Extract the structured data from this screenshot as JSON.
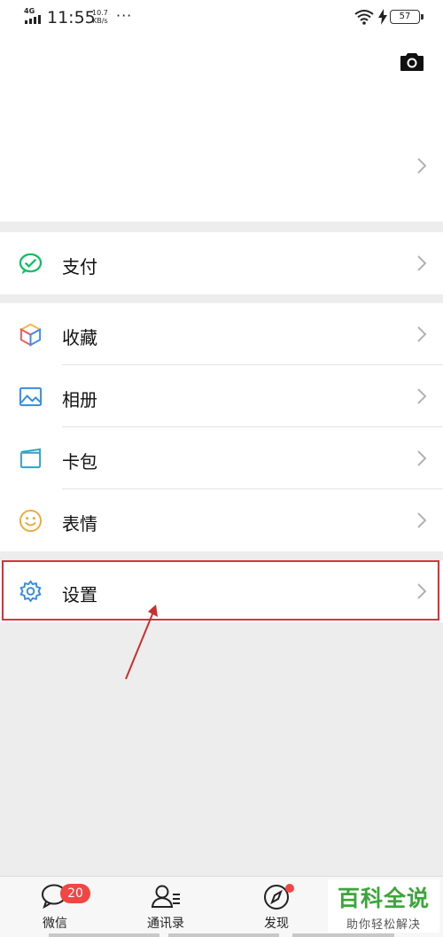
{
  "status_bar": {
    "network": "4G",
    "time": "11:55",
    "speed_value": "10.7",
    "speed_unit": "KB/s",
    "more": "···",
    "battery": "57"
  },
  "profile": {
    "camera_icon": "camera-icon",
    "chevron_icon": "chevron-right-icon"
  },
  "menu": {
    "pay": {
      "label": "支付",
      "icon": "wechat-pay-icon"
    },
    "favorites": {
      "label": "收藏",
      "icon": "cube-favorites-icon"
    },
    "album": {
      "label": "相册",
      "icon": "image-album-icon"
    },
    "cards": {
      "label": "卡包",
      "icon": "card-wallet-icon"
    },
    "stickers": {
      "label": "表情",
      "icon": "smiley-icon"
    },
    "settings": {
      "label": "设置",
      "icon": "gear-icon"
    }
  },
  "tabbar": {
    "chats": {
      "label": "微信",
      "badge": "20"
    },
    "contacts": {
      "label": "通讯录"
    },
    "discover": {
      "label": "发现"
    }
  },
  "watermark": {
    "title": "百科全说",
    "subtitle": "助你轻松解决"
  },
  "colors": {
    "accent_green": "#07c160",
    "highlight_red": "#d6333f",
    "badge_red": "#f44545",
    "background": "#ededed"
  }
}
